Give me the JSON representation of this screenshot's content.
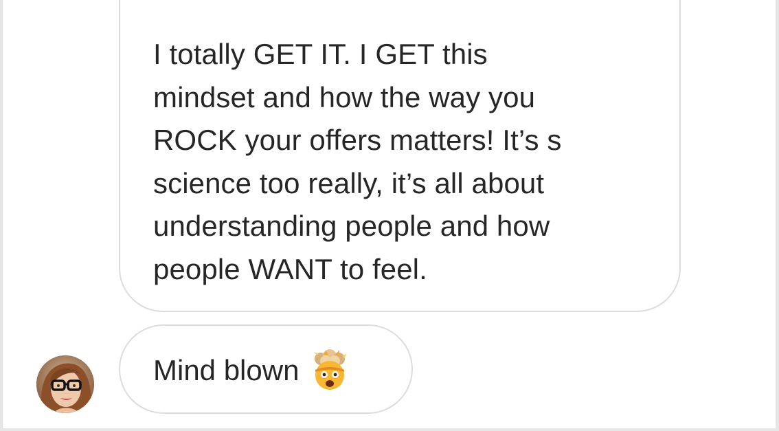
{
  "conversation": {
    "message_1": {
      "text": "I totally GET IT. I GET this\nmindset and how the way you\nROCK your offers matters! It’s s\nscience too really, it’s all about\nunderstanding people and how\npeople WANT to feel."
    },
    "message_2": {
      "text": "Mind blown",
      "emoji": "exploding-head-emoji"
    },
    "sender_avatar": "avatar-woman-glasses"
  },
  "colors": {
    "bubble_border": "#dcdcdc",
    "text": "#262626",
    "background": "#ffffff",
    "outer_border": "#e6e6e6"
  }
}
